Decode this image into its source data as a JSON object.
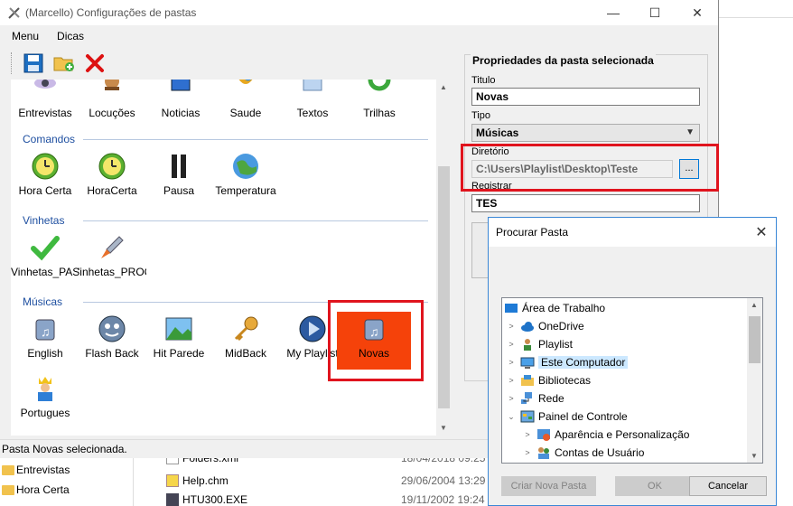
{
  "window": {
    "title": "(Marcello) Configurações de pastas",
    "minimize": "—",
    "maximize": "☐",
    "close": "✕"
  },
  "menu": [
    "Menu",
    "Dicas"
  ],
  "toolbar": {
    "save_icon": "floppy-disk-icon",
    "new_folder_icon": "new-folder-icon",
    "delete_icon": "red-x-delete-icon"
  },
  "top_row": [
    "Entrevistas",
    "Locuções",
    "Noticias",
    "Saude",
    "Textos",
    "Trilhas"
  ],
  "groups": {
    "comandos": {
      "label": "Comandos",
      "items": [
        "Hora Certa",
        "HoraCerta",
        "Pausa",
        "Temperatura"
      ]
    },
    "vinhetas": {
      "label": "Vinhetas",
      "items": [
        "Vinhetas_PAS",
        "'inhetas_PROC"
      ]
    },
    "musicas": {
      "label": "Músicas",
      "items": [
        "English",
        "Flash Back",
        "Hit Parede",
        "MidBack",
        "My Playlist",
        "Novas",
        "Portugues"
      ]
    }
  },
  "status": "Pasta Novas selecionada.",
  "properties": {
    "header": "Propriedades da pasta selecionada",
    "titulo_label": "Titulo",
    "titulo_value": "Novas",
    "tipo_label": "Tipo",
    "tipo_value": "Músicas",
    "diretorio_label": "Diretório",
    "diretorio_value": "C:\\Users\\Playlist\\Desktop\\Teste",
    "browse_label": "...",
    "registrar_label": "Registrar",
    "registrar_value": "TES"
  },
  "dialog": {
    "title": "Procurar Pasta",
    "close": "✕",
    "tree": [
      "Área de Trabalho",
      "OneDrive",
      "Playlist",
      "Este Computador",
      "Bibliotecas",
      "Rede",
      "Painel de Controle",
      "Aparência e Personalização",
      "Contas de Usuário"
    ],
    "new_folder": "Criar Nova Pasta",
    "ok": "OK",
    "cancel": "Cancelar"
  },
  "background": {
    "left_items": [
      "Entrevistas",
      "Hora Certa"
    ],
    "files": [
      {
        "name": "Folders.xml",
        "date": "18/04/2018 09:25"
      },
      {
        "name": "Help.chm",
        "date": "29/06/2004 13:29"
      },
      {
        "name": "HTU300.EXE",
        "date": "19/11/2002 19:24"
      }
    ]
  },
  "colors": {
    "selected_bg": "#f5420a",
    "highlight_red": "#e0141e",
    "group_label": "#1e4fa0"
  }
}
